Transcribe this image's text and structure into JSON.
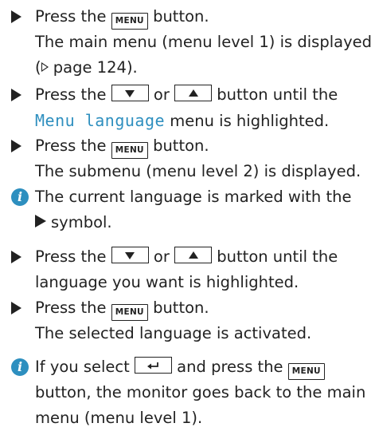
{
  "keys": {
    "menu": "MENU",
    "down_icon": "down-arrow-icon",
    "up_icon": "up-arrow-icon",
    "enter_icon": "return-arrow-icon"
  },
  "steps": [
    {
      "a": "Press the ",
      "b": " button.",
      "result": "The main menu (menu level 1) is displayed",
      "result2_pre": "(",
      "page_ref": " page 124",
      "result2_post": ")."
    },
    {
      "a": "Press the ",
      "or": " or ",
      "b": " button until the",
      "menu_name": "Menu language",
      "c": " menu is highlighted."
    },
    {
      "a": "Press the ",
      "b": " button.",
      "result": "The submenu (menu level 2) is displayed."
    }
  ],
  "info1": {
    "line1": "The current language is marked with the",
    "line2": "symbol."
  },
  "steps2": [
    {
      "a": "Press the ",
      "or": " or ",
      "b": " button until the",
      "c": "language you want is highlighted."
    },
    {
      "a": "Press the ",
      "b": " button.",
      "result": "The selected language is activated."
    }
  ],
  "info2": {
    "a": "If you select ",
    "b": " and press the ",
    "c": "button, the monitor goes back to the main",
    "d": "menu (menu level 1)."
  },
  "colors": {
    "accent": "#2e8fbf",
    "text": "#222222",
    "info_icon": "#2d8fbf"
  }
}
